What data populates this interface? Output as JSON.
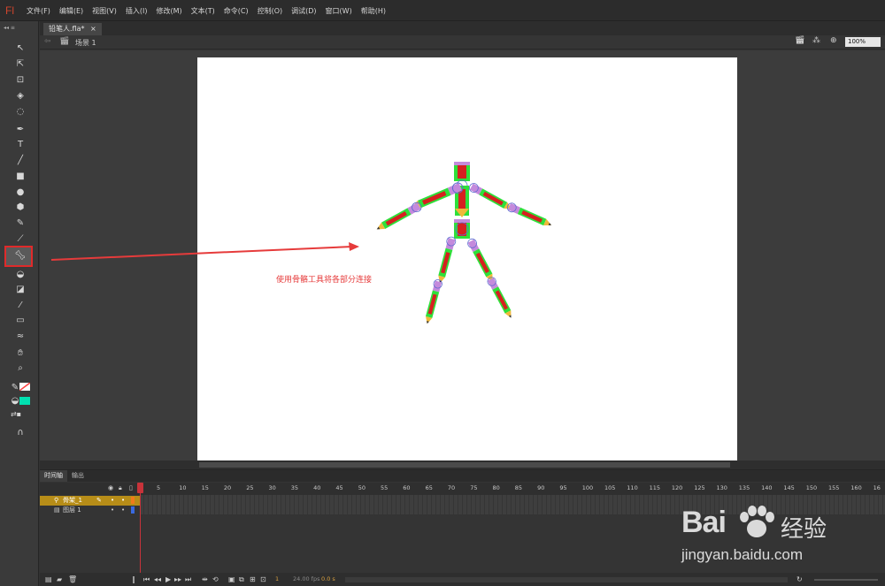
{
  "app": {
    "logo": "Fl"
  },
  "menu": [
    "文件(F)",
    "编辑(E)",
    "视图(V)",
    "插入(I)",
    "修改(M)",
    "文本(T)",
    "命令(C)",
    "控制(O)",
    "调试(D)",
    "窗口(W)",
    "帮助(H)"
  ],
  "document": {
    "tab_title": "铅笔人.fla*",
    "scene": "场景 1",
    "zoom": "100%"
  },
  "stage": {
    "caption": "使用骨骼工具将各部分连接",
    "background": "#ffffff",
    "annotation_color": "#e63b3b"
  },
  "tools": {
    "selected": "bone-tool",
    "fill_color": "#00e0b0",
    "stroke_color": "#ff4040"
  },
  "timeline": {
    "tabs": [
      "时间轴",
      "输出"
    ],
    "layers": [
      {
        "name": "骨架_1",
        "selected": true
      },
      {
        "name": "图层 1",
        "selected": false
      }
    ],
    "frame_numbers": [
      "1",
      "5",
      "10",
      "15",
      "20",
      "25",
      "30",
      "35",
      "40",
      "45",
      "50",
      "55",
      "60",
      "65",
      "70",
      "75",
      "80",
      "85",
      "90",
      "95",
      "100",
      "105",
      "110",
      "115",
      "120",
      "125",
      "130",
      "135",
      "140",
      "145",
      "150",
      "155",
      "160",
      "16"
    ],
    "current_frame": "1",
    "fps": "24.00 fps",
    "elapsed": "0.0 s"
  },
  "watermark": {
    "logo": "Bai",
    "logo_cn": "经验",
    "url": "jingyan.baidu.com"
  }
}
